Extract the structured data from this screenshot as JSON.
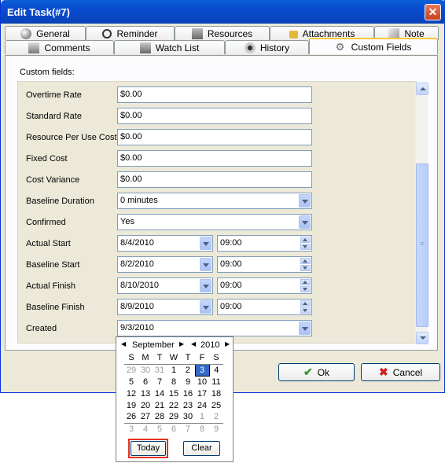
{
  "window": {
    "title": "Edit Task(#7)"
  },
  "tabs_row1": [
    {
      "label": "General",
      "icon": "general-icon"
    },
    {
      "label": "Reminder",
      "icon": "alarm-clock-icon"
    },
    {
      "label": "Resources",
      "icon": "resources-icon"
    },
    {
      "label": "Attachments",
      "icon": "lock-icon"
    },
    {
      "label": "Note",
      "icon": "note-icon"
    }
  ],
  "tabs_row2": [
    {
      "label": "Comments",
      "icon": "comments-icon"
    },
    {
      "label": "Watch List",
      "icon": "watch-list-icon"
    },
    {
      "label": "History",
      "icon": "history-icon"
    },
    {
      "label": "Custom Fields",
      "icon": "gear-icon",
      "active": true
    }
  ],
  "custom_fields": {
    "heading": "Custom fields:",
    "rows": [
      {
        "label": "Overtime Rate",
        "value": "$0.00"
      },
      {
        "label": "Standard Rate",
        "value": "$0.00"
      },
      {
        "label": "Resource Per Use Cost",
        "value": "$0.00"
      },
      {
        "label": "Fixed Cost",
        "value": "$0.00"
      },
      {
        "label": "Cost Variance",
        "value": "$0.00"
      },
      {
        "label": "Baseline Duration",
        "value": "0 minutes"
      },
      {
        "label": "Confirmed",
        "value": "Yes"
      },
      {
        "label": "Actual Start",
        "value": "8/4/2010",
        "time": "09:00"
      },
      {
        "label": "Baseline Start",
        "value": "8/2/2010",
        "time": "09:00"
      },
      {
        "label": "Actual Finish",
        "value": "8/10/2010",
        "time": "09:00"
      },
      {
        "label": "Baseline Finish",
        "value": "8/9/2010",
        "time": "09:00"
      },
      {
        "label": "Created",
        "value": "9/3/2010"
      }
    ]
  },
  "buttons": {
    "ok": "Ok",
    "cancel": "Cancel"
  },
  "calendar": {
    "month": "September",
    "year": "2010",
    "weekdays": [
      "S",
      "M",
      "T",
      "W",
      "T",
      "F",
      "S"
    ],
    "weeks": [
      [
        "29",
        "30",
        "31",
        "1",
        "2",
        "3",
        "4"
      ],
      [
        "5",
        "6",
        "7",
        "8",
        "9",
        "10",
        "11"
      ],
      [
        "12",
        "13",
        "14",
        "15",
        "16",
        "17",
        "18"
      ],
      [
        "19",
        "20",
        "21",
        "22",
        "23",
        "24",
        "25"
      ],
      [
        "26",
        "27",
        "28",
        "29",
        "30",
        "1",
        "2"
      ],
      [
        "3",
        "4",
        "5",
        "6",
        "7",
        "8",
        "9"
      ]
    ],
    "selected": "3",
    "today_label": "Today",
    "clear_label": "Clear"
  }
}
